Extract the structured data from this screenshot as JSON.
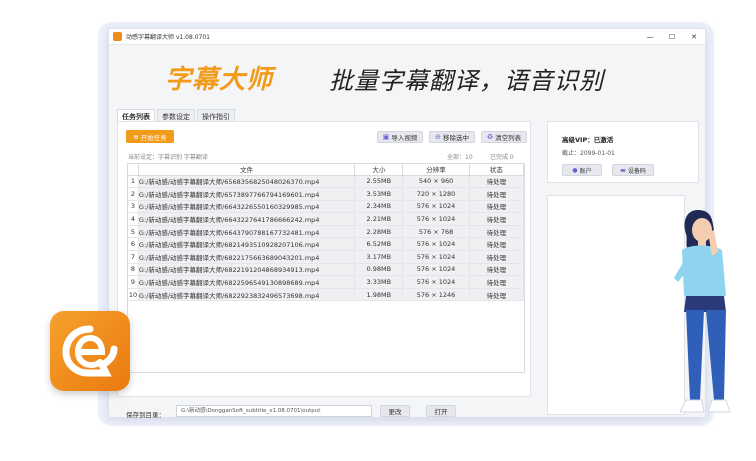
{
  "window": {
    "title": "动感字幕翻译大师 v1.08.0701",
    "controls": [
      "—",
      "☐",
      "✕"
    ]
  },
  "banner": {
    "brand": "字幕大师",
    "slogan": "批量字幕翻译，语音识别"
  },
  "tabs": [
    "任务列表",
    "参数设定",
    "操作指引"
  ],
  "toolbar": {
    "start_label": "开始任务",
    "import_label": "导入视频",
    "remove_label": "移除选中",
    "clear_label": "清空列表"
  },
  "settings_line": "当前设定：字幕识别 字幕翻译",
  "stats": {
    "total": "全部：10",
    "done": "已完成 0"
  },
  "table": {
    "headers": [
      "文件",
      "大小",
      "分辨率",
      "状态"
    ],
    "rows": [
      {
        "idx": "1",
        "file": "G:/新动感/动感字幕翻译大师/6568356825048026370.mp4",
        "size": "2.55MB",
        "res": "540 × 960",
        "status": "待处理"
      },
      {
        "idx": "2",
        "file": "G:/新动感/动感字幕翻译大师/6573897766794169601.mp4",
        "size": "3.53MB",
        "res": "720 × 1280",
        "status": "待处理"
      },
      {
        "idx": "3",
        "file": "G:/新动感/动感字幕翻译大师/6643226550160329985.mp4",
        "size": "2.34MB",
        "res": "576 × 1024",
        "status": "待处理"
      },
      {
        "idx": "4",
        "file": "G:/新动感/动感字幕翻译大师/6643227641786666242.mp4",
        "size": "2.21MB",
        "res": "576 × 1024",
        "status": "待处理"
      },
      {
        "idx": "5",
        "file": "G:/新动感/动感字幕翻译大师/6643790788167732481.mp4",
        "size": "2.28MB",
        "res": "576 × 768",
        "status": "待处理"
      },
      {
        "idx": "6",
        "file": "G:/新动感/动感字幕翻译大师/6821493510928207106.mp4",
        "size": "6.52MB",
        "res": "576 × 1024",
        "status": "待处理"
      },
      {
        "idx": "7",
        "file": "G:/新动感/动感字幕翻译大师/6822175663689043201.mp4",
        "size": "3.17MB",
        "res": "576 × 1024",
        "status": "待处理"
      },
      {
        "idx": "8",
        "file": "G:/新动感/动感字幕翻译大师/6822191204868934913.mp4",
        "size": "0.98MB",
        "res": "576 × 1024",
        "status": "待处理"
      },
      {
        "idx": "9",
        "file": "G:/新动感/动感字幕翻译大师/6822596549130898689.mp4",
        "size": "3.33MB",
        "res": "576 × 1024",
        "status": "待处理"
      },
      {
        "idx": "10",
        "file": "G:/新动感/动感字幕翻译大师/6822923832496573698.mp4",
        "size": "1.98MB",
        "res": "576 × 1246",
        "status": "待处理"
      }
    ]
  },
  "save": {
    "label": "保存到目录：",
    "path": "G:\\新动感\\DongganSoft_subtitle_v1.08.0701\\output",
    "change_label": "更改",
    "open_label": "打开"
  },
  "account": {
    "vip": "高级VIP：已激活",
    "expire": "截止：2099-01-01",
    "account_label": "账户",
    "device_label": "设备码"
  },
  "colors": {
    "accent": "#f29a1a",
    "icon": "#6a5bd6"
  },
  "icons": {
    "logo": "e-chat-logo-icon",
    "start": "plus-circle-icon"
  }
}
